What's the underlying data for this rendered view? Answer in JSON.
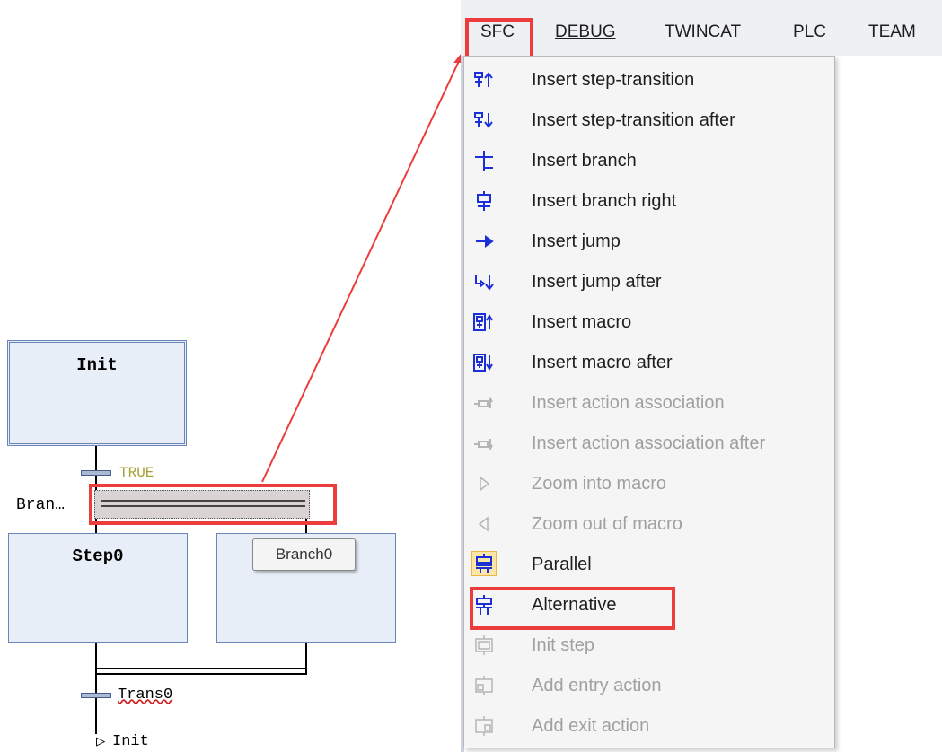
{
  "menubar": {
    "items": [
      "SFC",
      "DEBUG",
      "TWINCAT",
      "PLC",
      "TEAM"
    ]
  },
  "menu": {
    "items": [
      {
        "label": "Insert step-transition",
        "icon": "step-transition-up-icon",
        "enabled": true
      },
      {
        "label": "Insert step-transition after",
        "icon": "step-transition-down-icon",
        "enabled": true
      },
      {
        "label": "Insert branch",
        "icon": "branch-icon",
        "enabled": true
      },
      {
        "label": "Insert branch right",
        "icon": "branch-right-icon",
        "enabled": true
      },
      {
        "label": "Insert jump",
        "icon": "jump-arrow-icon",
        "enabled": true
      },
      {
        "label": "Insert jump after",
        "icon": "jump-after-icon",
        "enabled": true
      },
      {
        "label": "Insert macro",
        "icon": "macro-up-icon",
        "enabled": true
      },
      {
        "label": "Insert macro after",
        "icon": "macro-down-icon",
        "enabled": true
      },
      {
        "label": "Insert action association",
        "icon": "action-association-icon",
        "enabled": false
      },
      {
        "label": "Insert action association after",
        "icon": "action-association-after-icon",
        "enabled": false
      },
      {
        "label": "Zoom into macro",
        "icon": "zoom-in-macro-icon",
        "enabled": false
      },
      {
        "label": "Zoom out of macro",
        "icon": "zoom-out-macro-icon",
        "enabled": false
      },
      {
        "label": "Parallel",
        "icon": "parallel-icon",
        "enabled": true,
        "checked": true
      },
      {
        "label": "Alternative",
        "icon": "alternative-icon",
        "enabled": true
      },
      {
        "label": "Init step",
        "icon": "init-step-icon",
        "enabled": false
      },
      {
        "label": "Add entry action",
        "icon": "entry-action-icon",
        "enabled": false
      },
      {
        "label": "Add exit action",
        "icon": "exit-action-icon",
        "enabled": false
      }
    ]
  },
  "diagram": {
    "init_step": "Init",
    "transition_true": "TRUE",
    "branch_label": "Bran…",
    "step0": "Step0",
    "tooltip": "Branch0",
    "transition0": "Trans0",
    "jump_target": "Init"
  },
  "colors": {
    "highlight_red": "#ec3c3c",
    "step_fill": "#e8eef8",
    "step_border": "#6a85b8",
    "icon_blue": "#1a2fd6",
    "disabled_text": "#a0a0a0"
  }
}
